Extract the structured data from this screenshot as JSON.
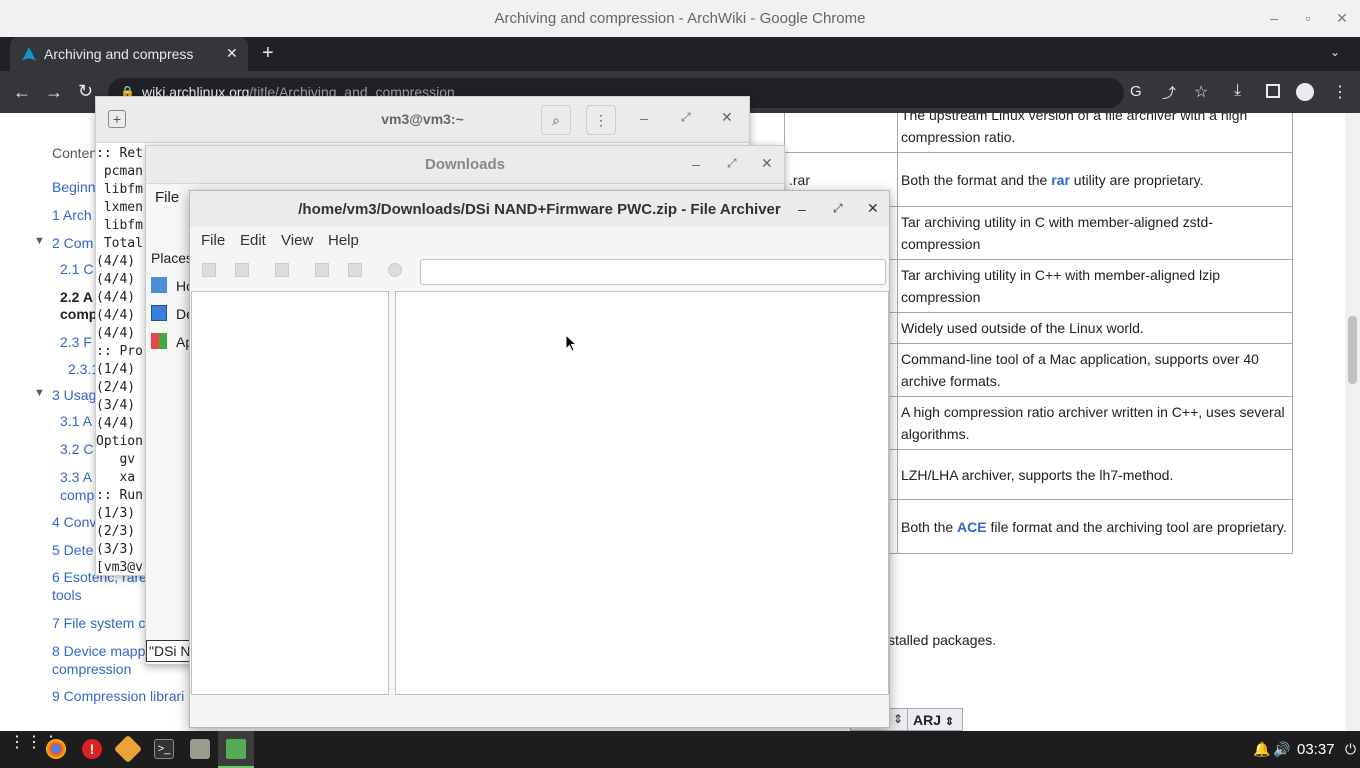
{
  "window_title": "Archiving and compression - ArchWiki - Google Chrome",
  "tab_title": "Archiving and compression",
  "url": {
    "domain": "wiki.archlinux.org",
    "path": "/title/Archiving_and_compression"
  },
  "toc": {
    "heading": "Conten",
    "items": [
      "Beginn",
      "1  Arch",
      "2  Com",
      "2.1  C",
      "2.2  A",
      "comp",
      "2.3  F",
      "2.3.1",
      "3  Usag",
      "3.1  A",
      "3.2  C",
      "3.3  A",
      "comp",
      "4  Conv",
      "5  Dete",
      "6  Esoteric, rare",
      "tools",
      "7  File system c",
      "8  Device mapp",
      "compression",
      "9  Compression librari"
    ]
  },
  "table": {
    "rows": [
      {
        "left": "",
        "right": "The upstream Linux version of a file archiver with a high compression ratio."
      },
      {
        "left": ".rar",
        "right_parts": [
          "Both the format and the ",
          "rar",
          " utility are proprietary."
        ]
      },
      {
        "left": "",
        "right": "Tar archiving utility in C with member-aligned zstd-compression"
      },
      {
        "left": "",
        "right": "Tar archiving utility in C++ with member-aligned lzip compression"
      },
      {
        "left": "",
        "right": "Widely used outside of the Linux world."
      },
      {
        "left": "",
        "right": "Command-line tool of a Mac application, supports over 40 archive formats."
      },
      {
        "left": "",
        "right": "A high compression ratio archiver written in C++, uses several algorithms."
      },
      {
        "left": "",
        "right": "LZH/LHA archiver, supports the lh7-method."
      },
      {
        "left": "",
        "right_parts": [
          "Both the ",
          "ACE",
          " file format and the archiving tool are proprietary."
        ]
      }
    ]
  },
  "page_text": {
    "installed": "stalled packages.",
    "arj_header": "ARJ"
  },
  "terminal": {
    "title": "vm3@vm3:~",
    "lines": [
      ":: Ret",
      " pcman",
      " libfm",
      " lxmen",
      " libfm",
      " Total",
      "(4/4)",
      "(4/4)",
      "(4/4)",
      "(4/4)",
      "(4/4)",
      ":: Pro",
      "(1/4)",
      "(2/4)",
      "(3/4)",
      "(4/4)",
      "Option",
      "   gv",
      "   xa",
      ":: Run",
      "(1/3)",
      "(2/3)",
      "(3/3)",
      "[vm3@v"
    ]
  },
  "downloads": {
    "title": "Downloads",
    "menu_file": "File",
    "places_label": "Places",
    "places": [
      "Ho",
      "De",
      "Ap"
    ],
    "status": "\"DSi N"
  },
  "archiver": {
    "title": "/home/vm3/Downloads/DSi NAND+Firmware PWC.zip - File Archiver",
    "menu": [
      "File",
      "Edit",
      "View",
      "Help"
    ],
    "location": ""
  },
  "taskbar": {
    "clock": "03:37"
  },
  "colors": {
    "link": "#3366cc",
    "chrome_dark": "#202124"
  }
}
